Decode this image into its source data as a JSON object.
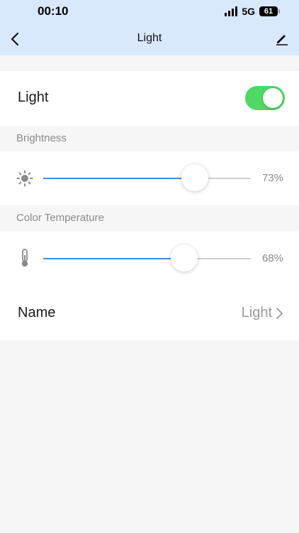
{
  "status_bar": {
    "time": "00:10",
    "network": "5G",
    "battery": "61"
  },
  "nav": {
    "title": "Light",
    "back_icon": "chevron-left-icon",
    "edit_icon": "pencil-icon"
  },
  "light_row": {
    "label": "Light",
    "toggle_on": true,
    "toggle_color": "#4cd964"
  },
  "brightness": {
    "section_title": "Brightness",
    "icon": "sun-icon",
    "value": 73,
    "value_text": "73%"
  },
  "color_temperature": {
    "section_title": "Color Temperature",
    "icon": "thermometer-icon",
    "value": 68,
    "value_text": "68%"
  },
  "name_row": {
    "label": "Name",
    "value": "Light",
    "chevron_icon": "chevron-right-icon"
  },
  "colors": {
    "header_bg": "#d9e8fb",
    "accent": "#3a8ee6"
  }
}
